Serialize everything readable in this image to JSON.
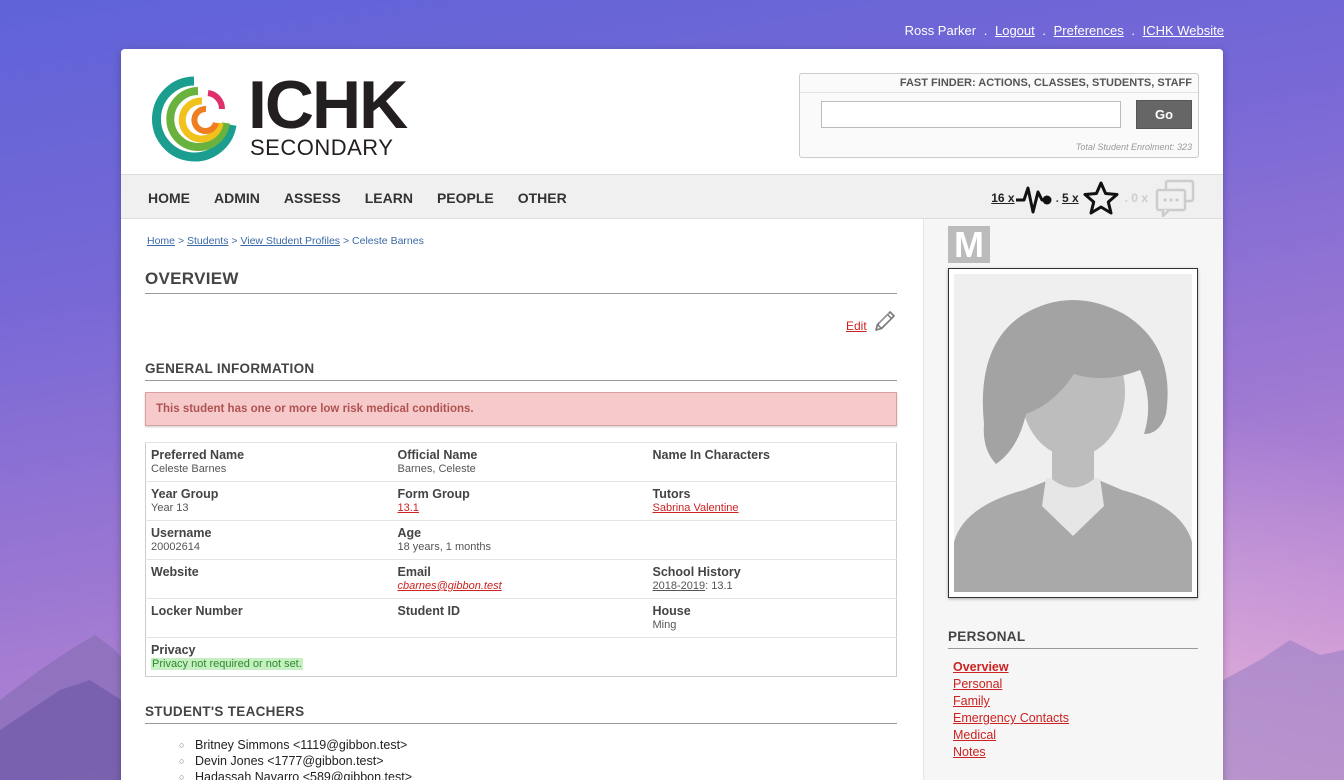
{
  "top_nav": {
    "user": "Ross Parker",
    "logout": "Logout",
    "preferences": "Preferences",
    "website": "ICHK Website",
    "sep": "."
  },
  "header": {
    "logo_word": "ICHK",
    "logo_sub": "SECONDARY",
    "finder_title": "FAST FINDER: ACTIONS, CLASSES, STUDENTS, STAFF",
    "finder_value": "",
    "go_label": "Go",
    "enrolment": "Total Student Enrolment: 323"
  },
  "menu": [
    "HOME",
    "ADMIN",
    "ASSESS",
    "LEARN",
    "PEOPLE",
    "OTHER"
  ],
  "notifications": {
    "alerts_count": "16 x",
    "likes_count": "5 x",
    "messages_count": ". 0 x",
    "sep": "."
  },
  "breadcrumb": {
    "home": "Home",
    "students": "Students",
    "profiles": "View Student Profiles",
    "current": "Celeste Barnes",
    "sep": ">"
  },
  "overview": {
    "title": "OVERVIEW",
    "edit": "Edit"
  },
  "general": {
    "title": "GENERAL INFORMATION",
    "alert": "This student has one or more low risk medical conditions.",
    "rows": [
      [
        {
          "label": "Preferred Name",
          "value": "Celeste Barnes"
        },
        {
          "label": "Official Name",
          "value": "Barnes, Celeste"
        },
        {
          "label": "Name In Characters",
          "value": ""
        }
      ],
      [
        {
          "label": "Year Group",
          "value": "Year 13"
        },
        {
          "label": "Form Group",
          "value": "13.1"
        },
        {
          "label": "Tutors",
          "value": "Sabrina Valentine"
        }
      ],
      [
        {
          "label": "Username",
          "value": "20002614"
        },
        {
          "label": "Age",
          "value": "18 years, 1 months"
        },
        {
          "label": "",
          "value": ""
        }
      ],
      [
        {
          "label": "Website",
          "value": ""
        },
        {
          "label": "Email",
          "value": "cbarnes@gibbon.test"
        },
        {
          "label": "School History",
          "value": "2018-2019",
          "value_suffix": ": 13.1"
        }
      ],
      [
        {
          "label": "Locker Number",
          "value": ""
        },
        {
          "label": "Student ID",
          "value": ""
        },
        {
          "label": "House",
          "value": "Ming"
        }
      ],
      [
        {
          "label": "Privacy",
          "value": "Privacy not required or not set."
        }
      ]
    ]
  },
  "teachers": {
    "title": "STUDENT'S TEACHERS",
    "list": [
      "Britney Simmons <1119@gibbon.test>",
      "Devin Jones <1777@gibbon.test>",
      "Hadassah Navarro <589@gibbon.test>"
    ]
  },
  "sidebar": {
    "badge": "M",
    "section_title": "PERSONAL",
    "links": [
      "Overview",
      "Personal",
      "Family",
      "Emergency Contacts",
      "Medical",
      "Notes"
    ]
  }
}
